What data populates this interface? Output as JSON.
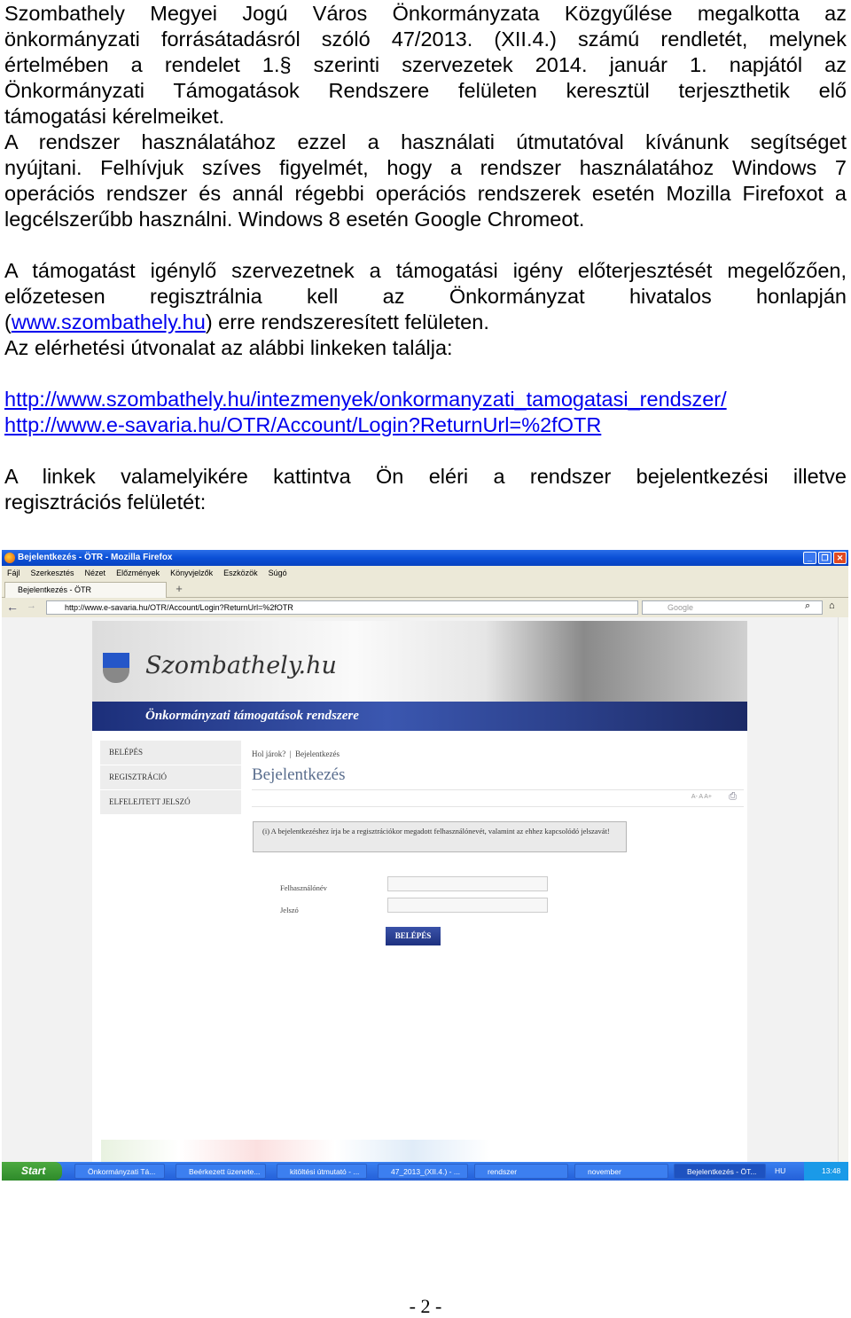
{
  "document": {
    "para1": [
      "Szombathely Megyei Jogú Város Önkormányzata Közgyűlése megalkotta az",
      "önkormányzati forrásátadásról szóló 47/2013. (XII.4.) számú rendletét, melynek",
      "értelmében a rendelet 1.§ szerinti szervezetek 2014. január 1. napjától az",
      "Önkormányzati Támogatások Rendszere felületen keresztül terjeszthetik elő",
      "támogatási kérelmeiket."
    ],
    "para2": [
      "A rendszer használatához ezzel a használati útmutatóval kívánunk segítséget",
      "nyújtani. Felhívjuk szíves figyelmét, hogy a rendszer használatához Windows 7",
      "operációs rendszer és annál régebbi operációs rendszerek esetén Mozilla Firefoxot a",
      "legcélszerűbb használni. Windows 8 esetén Google Chromeot."
    ],
    "para3": [
      "A támogatást igénylő szervezetnek a támogatási igény előterjesztését megelőzően,",
      "előzetesen regisztrálnia kell az Önkormányzat hivatalos honlapján"
    ],
    "para3_l3_open": "(",
    "para3_link": "www.szombathely.hu",
    "para3_l3_rest": ") erre rendszeresített felületen.",
    "para3_l4": "Az elérhetési útvonalat az alábbi linkeken találja:",
    "link1": "http://www.szombathely.hu/intezmenyek/onkormanyzati_tamogatasi_rendszer/",
    "link2": "http://www.e-savaria.hu/OTR/Account/Login?ReturnUrl=%2fOTR",
    "para4": [
      "A linkek valamelyikére kattintva Ön eléri a rendszer bejelentkezési illetve",
      "regisztrációs felületét:"
    ],
    "page_number": "- 2 -"
  },
  "screenshot": {
    "window_title": "Bejelentkezés - ÖTR - Mozilla Firefox",
    "menu": [
      "Fájl",
      "Szerkesztés",
      "Nézet",
      "Előzmények",
      "Könyvjelzők",
      "Eszközök",
      "Súgó"
    ],
    "tab": "Bejelentkezés - ÖTR",
    "url": "http://www.e-savaria.hu/OTR/Account/Login?ReturnUrl=%2fOTR",
    "search_placeholder": "Google",
    "site": {
      "logo": "Szombathely.hu",
      "band": "Önkormányzati támogatások rendszere",
      "sidebar": [
        "BELÉPÉS",
        "REGISZTRÁCIÓ",
        "ELFELEJTETT JELSZÓ"
      ],
      "breadcrumb_label": "Hol járok?",
      "breadcrumb_current": "Bejelentkezés",
      "heading": "Bejelentkezés",
      "font_controls": "A- A A+",
      "info": "(i) A bejelentkezéshez írja be a regisztrációkor megadott felhasználónevét, valamint az ehhez kapcsolódó jelszavát!",
      "username_label": "Felhasználónév",
      "password_label": "Jelszó",
      "submit": "BELÉPÉS"
    },
    "taskbar": {
      "start": "Start",
      "items": [
        "Önkormányzati Tá...",
        "Beérkezett üzenete...",
        "kitöltési útmutató - ...",
        "47_2013_(XII.4.) - ...",
        "rendszer",
        "november",
        "Bejelentkezés - ÖT..."
      ],
      "lang": "HU",
      "clock": "13:48"
    }
  }
}
